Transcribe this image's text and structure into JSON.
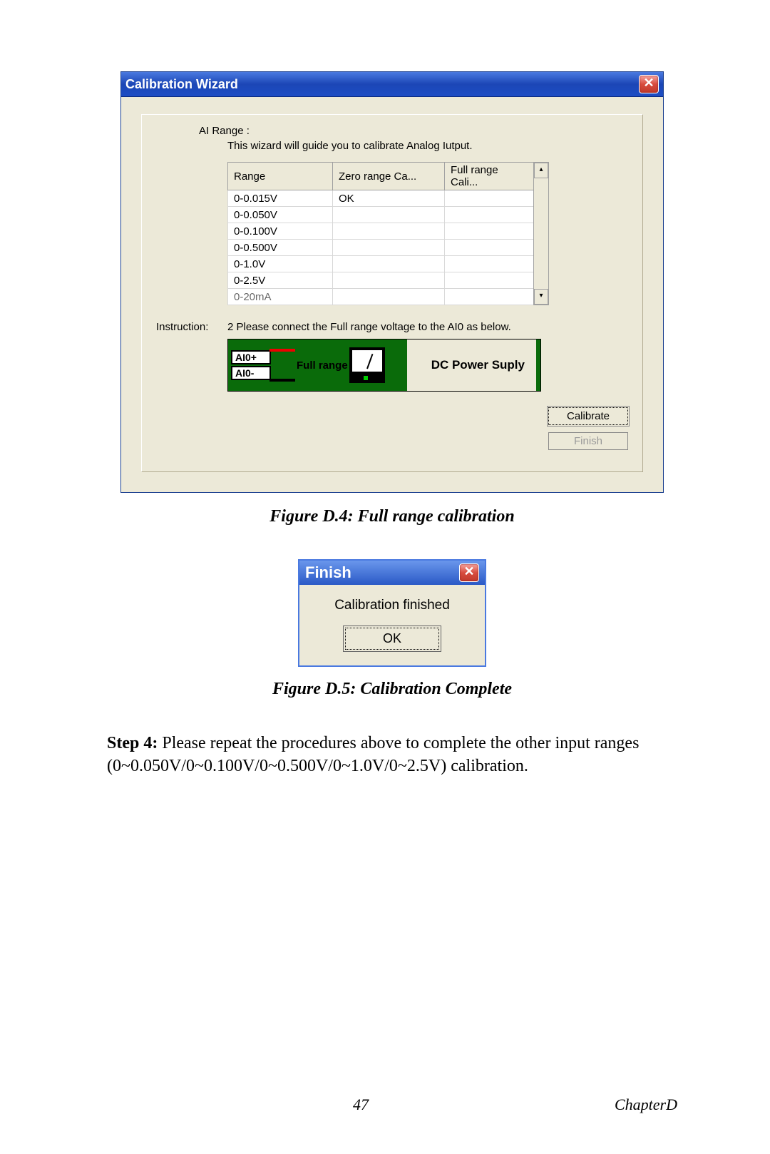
{
  "wizard": {
    "title": "Calibration Wizard",
    "ai_range_label": "AI Range :",
    "subtitle": "This wizard will guide you to calibrate Analog Iutput.",
    "columns": {
      "c0": "Range",
      "c1": "Zero range Ca...",
      "c2": "Full range Cali..."
    },
    "rows": [
      {
        "range": "0-0.015V",
        "zero": "OK",
        "full": ""
      },
      {
        "range": "0-0.050V",
        "zero": "",
        "full": ""
      },
      {
        "range": "0-0.100V",
        "zero": "",
        "full": ""
      },
      {
        "range": "0-0.500V",
        "zero": "",
        "full": ""
      },
      {
        "range": "0-1.0V",
        "zero": "",
        "full": ""
      },
      {
        "range": "0-2.5V",
        "zero": "",
        "full": ""
      },
      {
        "range": "0-20mA",
        "zero": "",
        "full": ""
      }
    ],
    "instruction_label": "Instruction:",
    "instruction_text": "2  Please connect the Full range voltage to the AI0 as below.",
    "diagram": {
      "pin_plus": "AI0+",
      "pin_minus": "AI0-",
      "full_range": "Full range",
      "dc_label": "DC Power Suply"
    },
    "buttons": {
      "calibrate": "Calibrate",
      "finish": "Finish"
    }
  },
  "figure_d4": "Figure D.4: Full range calibration",
  "finish_dialog": {
    "title": "Finish",
    "message": "Calibration finished",
    "ok": "OK"
  },
  "figure_d5": "Figure D.5:  Calibration Complete",
  "step4": {
    "bold": "Step 4: ",
    "rest": "Please repeat the procedures above to complete the other input ranges (0~0.050V/0~0.100V/0~0.500V/0~1.0V/0~2.5V) calibration."
  },
  "footer": {
    "page": "47",
    "chapter": "ChapterD"
  }
}
